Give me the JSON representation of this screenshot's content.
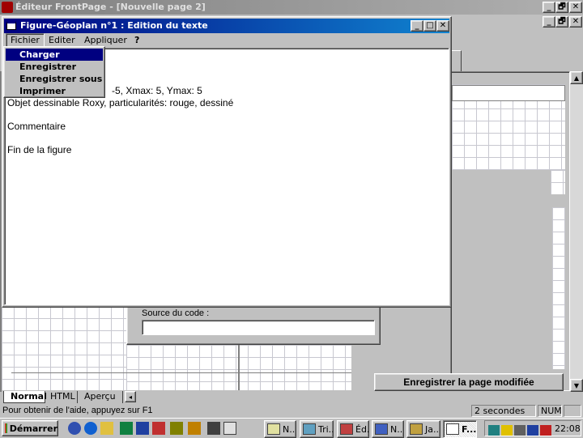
{
  "app": {
    "title": "Éditeur FrontPage - [Nouvelle page 2]",
    "title_buttons": [
      "_",
      "🗗",
      "✕"
    ],
    "mdi_buttons": [
      "_",
      "🗗",
      "✕"
    ]
  },
  "dialog": {
    "title": "Figure-Géoplan n°1 : Edition du texte",
    "menu": [
      "Fichier",
      "Editer",
      "Appliquer",
      "?"
    ],
    "dropdown": [
      "Charger",
      "Enregistrer",
      "Enregistrer sous",
      "Imprimer"
    ],
    "content_lines": [
      "-5, Xmax: 5, Ymax: 5",
      "Objet dessinable Roxy, particularités: rouge, dessiné",
      "",
      "Commentaire",
      "",
      "Fin de la figure"
    ]
  },
  "editor": {
    "source_label": "Source du code :",
    "save_button": "Enregistrer la page modifiée",
    "view_tabs": [
      "Normal",
      "HTML",
      "Aperçu"
    ]
  },
  "statusbar": {
    "help_text": "Pour obtenir de l'aide, appuyez sur F1",
    "time_text": "2 secondes",
    "num_text": "NUM"
  },
  "taskbar": {
    "start_label": "Démarrer",
    "tasks": [
      "N...",
      "Tri...",
      "Éd...",
      "N...",
      "Ja...",
      "F..."
    ],
    "clock": "22:08",
    "quick_launch_icons": [
      "netscape-icon",
      "ie-icon",
      "outlook-icon",
      "excel-icon",
      "word-icon",
      "access-icon",
      "tools-icon",
      "paint-icon",
      "desktop-icon"
    ],
    "tray_icons": [
      "network-icon",
      "volume-icon",
      "scanner-icon",
      "antivirus-icon",
      "acrobat-icon"
    ]
  },
  "colors": {
    "title_active": "#000080",
    "title_inactive": "#808080",
    "desktop": "#c0c0c0",
    "selection": "#000080"
  }
}
